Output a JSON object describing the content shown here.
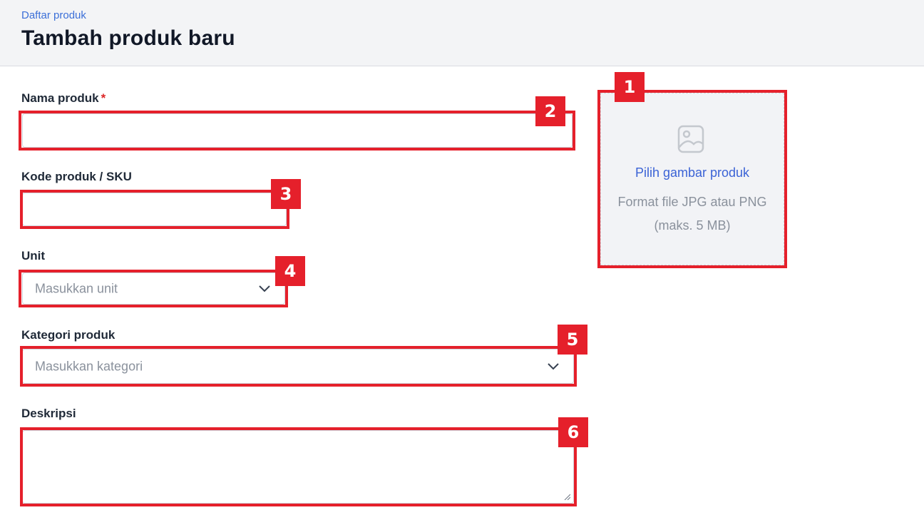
{
  "header": {
    "breadcrumb": "Daftar produk",
    "title": "Tambah produk baru"
  },
  "form": {
    "name": {
      "label": "Nama produk",
      "required_mark": "*",
      "value": ""
    },
    "sku": {
      "label": "Kode produk / SKU",
      "value": ""
    },
    "unit": {
      "label": "Unit",
      "placeholder": "Masukkan unit"
    },
    "category": {
      "label": "Kategori produk",
      "placeholder": "Masukkan kategori"
    },
    "description": {
      "label": "Deskripsi",
      "value": ""
    }
  },
  "image_upload": {
    "icon": "image-icon",
    "link_label": "Pilih gambar produk",
    "hint": "Format file JPG atau PNG (maks. 5 MB)"
  },
  "annotations": [
    "1",
    "2",
    "3",
    "4",
    "5",
    "6"
  ],
  "colors": {
    "annotation": "#e5202b",
    "link": "#3b63d6",
    "required": "#dc2626"
  }
}
